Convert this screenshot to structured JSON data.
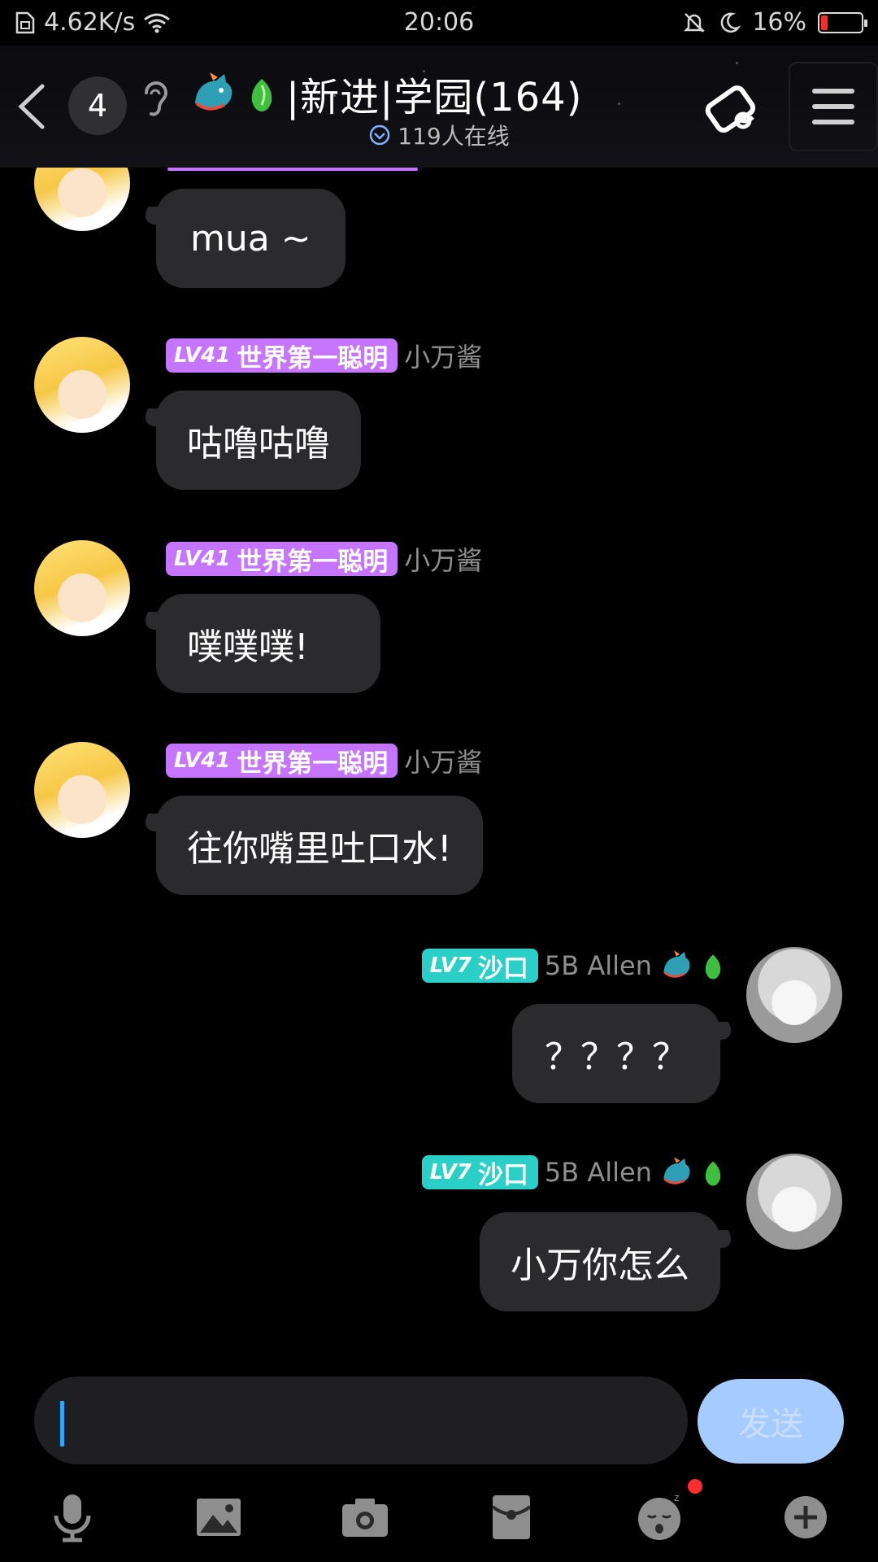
{
  "status_bar": {
    "speed": "4.62K/s",
    "time": "20:06",
    "battery_percent": "16%",
    "battery_level": 0.16
  },
  "header": {
    "unread_count": "4",
    "title": "|新进|学园(164)",
    "online_count": "119人在线",
    "icons": [
      "back-icon",
      "ear-icon",
      "dragon-badge-icon",
      "sprout-badge-icon",
      "rotate-device-icon",
      "menu-icon"
    ]
  },
  "messages": [
    {
      "side": "left",
      "text": "mua ~",
      "level": "",
      "tag": "",
      "nick": ""
    },
    {
      "side": "left",
      "text": "咕噜咕噜",
      "level": "LV41",
      "tag": "世界第一聪明",
      "nick": "小万酱"
    },
    {
      "side": "left",
      "text": "噗噗噗!",
      "level": "LV41",
      "tag": "世界第一聪明",
      "nick": "小万酱"
    },
    {
      "side": "left",
      "text": "往你嘴里吐口水!",
      "level": "LV41",
      "tag": "世界第一聪明",
      "nick": "小万酱"
    },
    {
      "side": "right",
      "text": "？？？？",
      "level": "LV7",
      "tag": "沙口",
      "nick": "5B Allen"
    },
    {
      "side": "right",
      "text": "小万你怎么",
      "level": "LV7",
      "tag": "沙口",
      "nick": "5B Allen"
    }
  ],
  "composer": {
    "input_value": "",
    "send_label": "发送"
  },
  "toolbar": {
    "items": [
      "microphone-icon",
      "image-icon",
      "camera-icon",
      "red-packet-icon",
      "sticker-icon",
      "plus-icon"
    ]
  },
  "colors": {
    "background": "#000000",
    "bubble": "#2b2b2d",
    "tag_purple": "#c575ff",
    "tag_teal": "#2ad0c8",
    "send_button": "#a6ccff",
    "caret": "#2aa7ff"
  }
}
